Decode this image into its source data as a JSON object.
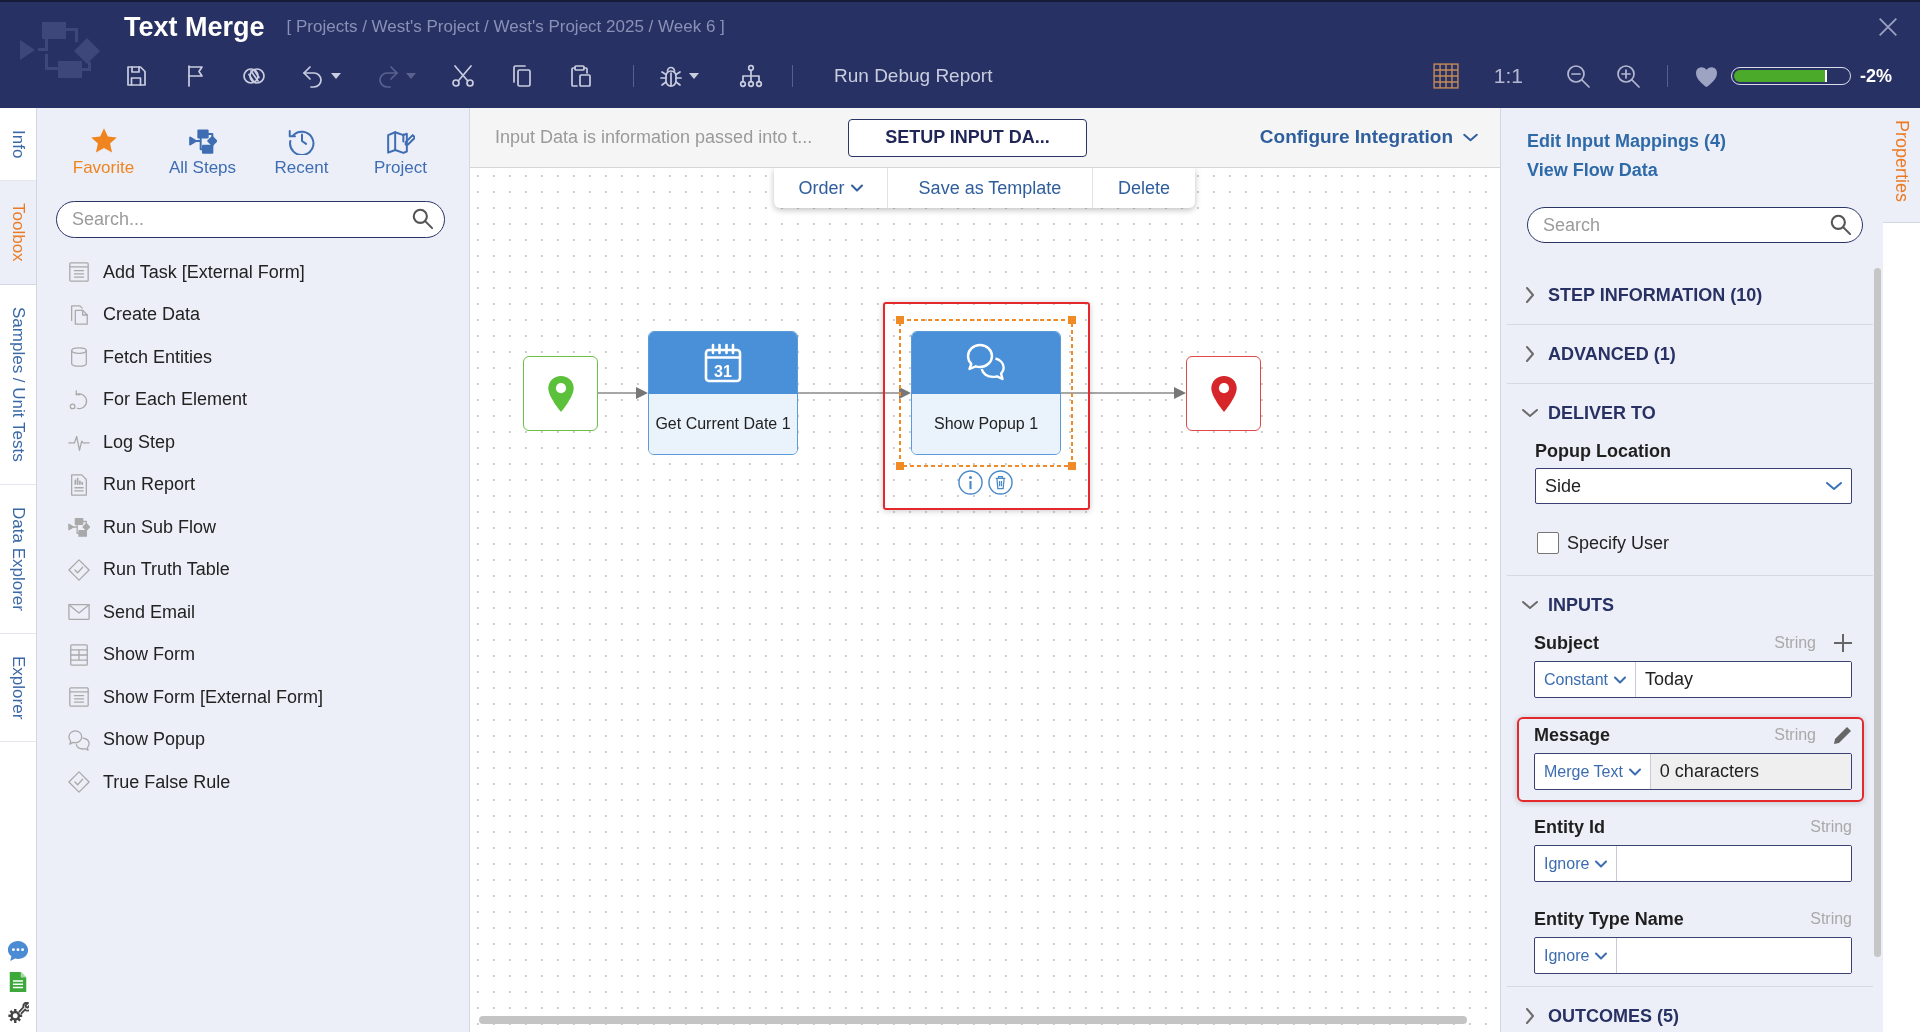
{
  "window": {
    "title": "Text Merge",
    "breadcrumb": "[ Projects / West's Project / West's Project 2025 / Week 6 ]"
  },
  "toolbar": {
    "groups": [
      {
        "buttons": [
          {
            "menu": false,
            "disabled": false
          },
          {
            "menu": false,
            "disabled": false
          },
          {
            "menu": false,
            "disabled": false
          },
          {
            "menu": true,
            "disabled": false
          },
          {
            "menu": true,
            "disabled": true
          },
          {
            "menu": false,
            "disabled": false
          },
          {
            "menu": false,
            "disabled": false
          },
          {
            "menu": false,
            "disabled": false
          }
        ]
      },
      {
        "buttons": [
          {
            "menu": true,
            "disabled": false
          },
          {
            "menu": false,
            "disabled": false
          }
        ]
      }
    ],
    "report_button": "Run Debug Report"
  },
  "view_controls": {
    "grid_on": true,
    "actual_size_button": "1:1",
    "health": {
      "level": 0.82,
      "reading": "-2%"
    }
  },
  "side_tabs": [
    {
      "label": "Info",
      "selected": false
    },
    {
      "label": "Toolbox",
      "selected": true
    },
    {
      "label": "Samples / Unit Tests",
      "selected": false
    },
    {
      "label": "Data Explorer",
      "selected": false
    },
    {
      "label": "Explorer",
      "selected": false
    }
  ],
  "toolbox": {
    "tabs": [
      {
        "label": "Favorite",
        "selected": true
      },
      {
        "label": "All Steps",
        "selected": false
      },
      {
        "label": "Recent",
        "selected": false
      },
      {
        "label": "Project",
        "selected": false
      }
    ],
    "search": {
      "placeholder": "Search..."
    },
    "items": [
      "Add Task [External Form]",
      "Create Data",
      "Fetch Entities",
      "For Each Element",
      "Log Step",
      "Run Report",
      "Run Sub Flow",
      "Run Truth Table",
      "Send Email",
      "Show Form",
      "Show Form [External Form]",
      "Show Popup",
      "True False Rule"
    ]
  },
  "canvas": {
    "info_text": "Input Data is information passed into t...",
    "setup_button": "SETUP INPUT DA...",
    "integration_menu": "Configure Integration",
    "context_menu": [
      {
        "label": "Order",
        "menu": true
      },
      {
        "label": "Save as Template",
        "menu": false
      },
      {
        "label": "Delete",
        "menu": false
      }
    ],
    "nodes": [
      {
        "kind": "start",
        "selected": false,
        "highlighted": false
      },
      {
        "kind": "step",
        "label": "Get Current Date 1",
        "icon_text": "31",
        "selected": false,
        "highlighted": false
      },
      {
        "kind": "step",
        "label": "Show Popup 1",
        "selected": true,
        "highlighted": true
      },
      {
        "kind": "end",
        "selected": false,
        "highlighted": false
      }
    ]
  },
  "properties": {
    "tab": {
      "label": "Properties",
      "selected": true
    },
    "links": [
      "Edit Input Mappings (4)",
      "View Flow Data"
    ],
    "search": {
      "placeholder": "Search"
    },
    "sections": [
      {
        "title": "STEP INFORMATION (10)",
        "expanded": false
      },
      {
        "title": "ADVANCED (1)",
        "expanded": false
      },
      {
        "title": "DELIVER TO",
        "expanded": true,
        "fields": [
          {
            "kind": "select",
            "label": "Popup Location",
            "value": "Side"
          },
          {
            "kind": "checkbox",
            "label": "Specify User",
            "checked": false
          }
        ]
      },
      {
        "title": "INPUTS",
        "expanded": true,
        "fields": [
          {
            "kind": "mapping",
            "label": "Subject",
            "type": "String",
            "addable": true,
            "editable": false,
            "mode": "Constant",
            "value": "Today",
            "readonly": false,
            "highlighted": false
          },
          {
            "kind": "mapping",
            "label": "Message",
            "type": "String",
            "addable": false,
            "editable": true,
            "mode": "Merge Text",
            "value": "0 characters",
            "readonly": true,
            "highlighted": true
          },
          {
            "kind": "mapping",
            "label": "Entity Id",
            "type": "String",
            "addable": false,
            "editable": false,
            "mode": "Ignore",
            "readonly": false,
            "highlighted": false
          },
          {
            "kind": "mapping",
            "label": "Entity Type Name",
            "type": "String",
            "addable": false,
            "editable": false,
            "mode": "Ignore",
            "readonly": false,
            "highlighted": false
          }
        ]
      },
      {
        "title": "OUTCOMES (5)",
        "expanded": false
      }
    ]
  }
}
